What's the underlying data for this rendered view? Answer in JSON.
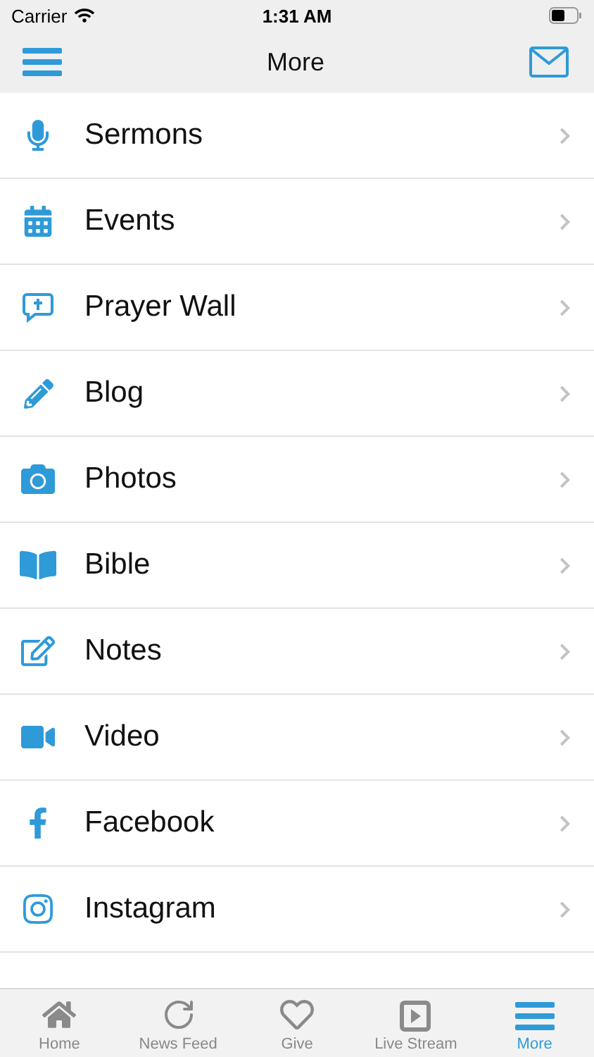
{
  "status_bar": {
    "carrier": "Carrier",
    "time": "1:31 AM"
  },
  "nav_bar": {
    "title": "More"
  },
  "menu": [
    {
      "label": "Sermons"
    },
    {
      "label": "Events"
    },
    {
      "label": "Prayer Wall"
    },
    {
      "label": "Blog"
    },
    {
      "label": "Photos"
    },
    {
      "label": "Bible"
    },
    {
      "label": "Notes"
    },
    {
      "label": "Video"
    },
    {
      "label": "Facebook"
    },
    {
      "label": "Instagram"
    }
  ],
  "tab_bar": [
    {
      "label": "Home",
      "selected": false
    },
    {
      "label": "News Feed",
      "selected": false
    },
    {
      "label": "Give",
      "selected": false
    },
    {
      "label": "Live Stream",
      "selected": false
    },
    {
      "label": "More",
      "selected": true
    }
  ]
}
